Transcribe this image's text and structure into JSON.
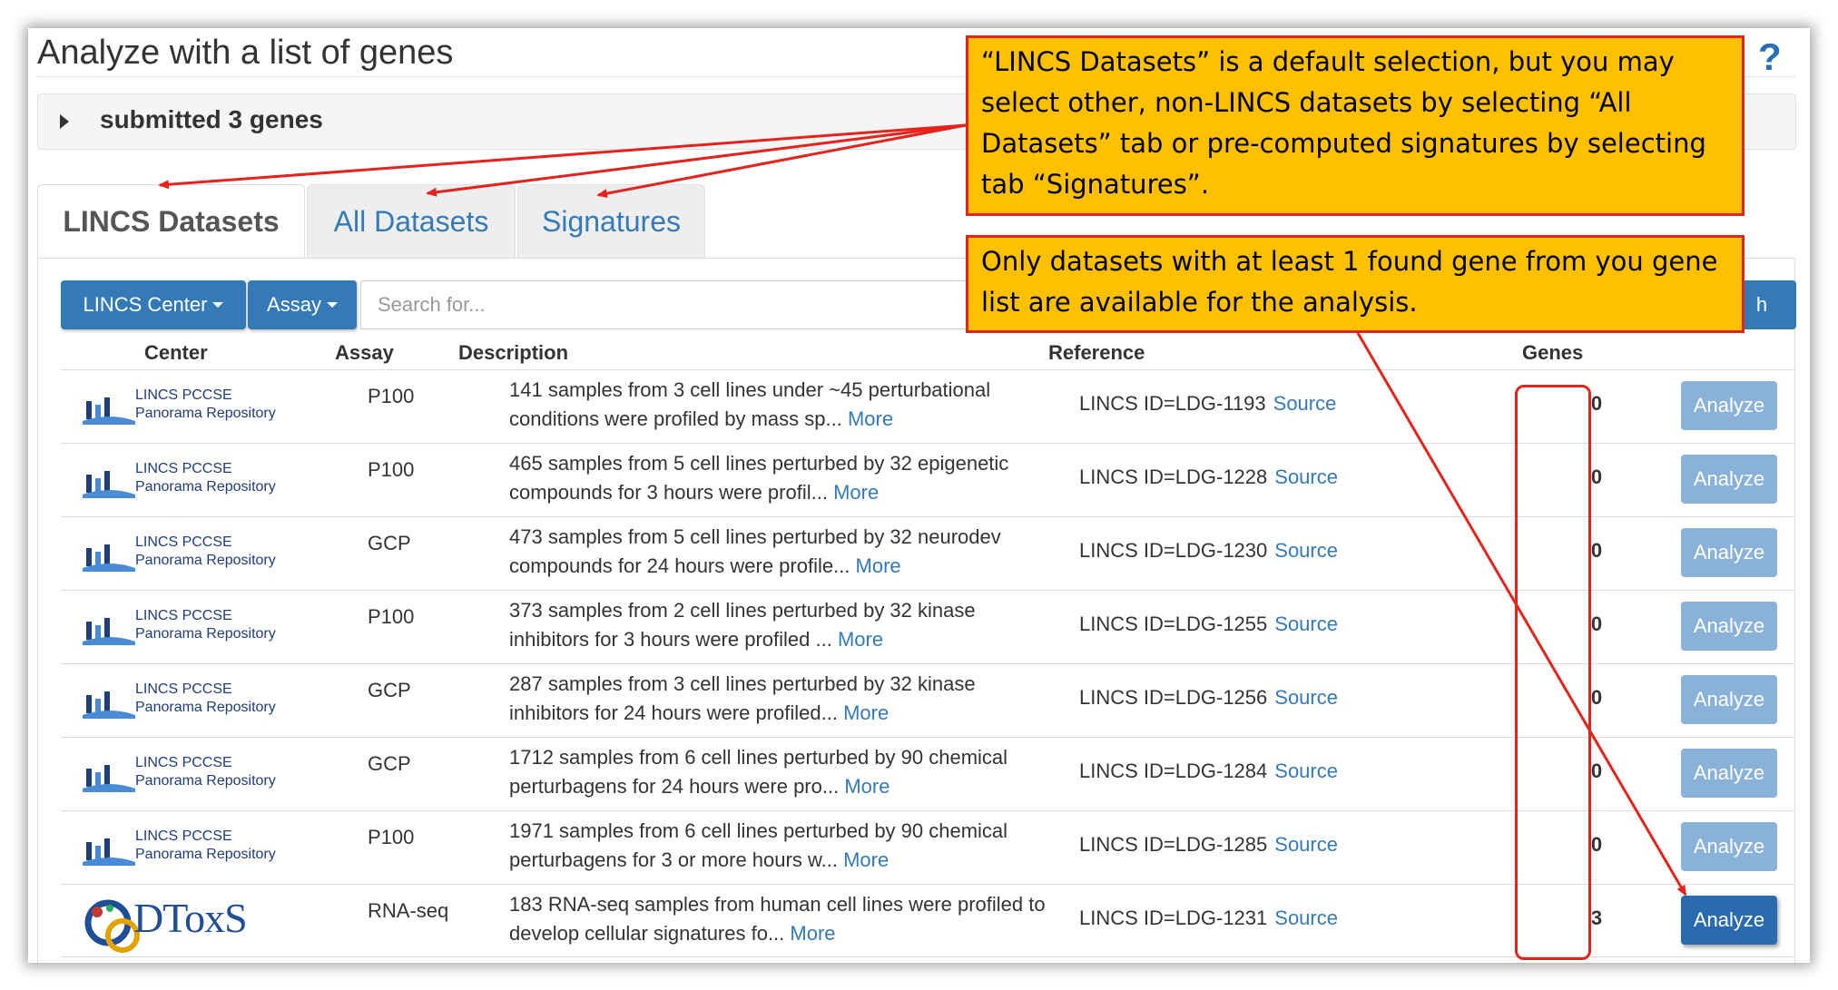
{
  "page": {
    "title": "Analyze with a list of genes",
    "help_symbol": "?"
  },
  "genes_panel": {
    "label": "submitted 3 genes"
  },
  "tabs": [
    {
      "label": "LINCS Datasets",
      "active": true
    },
    {
      "label": "All Datasets",
      "active": false
    },
    {
      "label": "Signatures",
      "active": false
    }
  ],
  "filters": {
    "center_label": "LINCS Center",
    "assay_label": "Assay",
    "search_placeholder": "Search for...",
    "search_button_label": "h"
  },
  "table": {
    "headers": {
      "center": "Center",
      "assay": "Assay",
      "description": "Description",
      "reference": "Reference",
      "genes": "Genes"
    },
    "more_label": "More",
    "source_label": "Source",
    "analyze_label": "Analyze",
    "rows": [
      {
        "center_line1": "LINCS PCCSE",
        "center_line2": "Panorama Repository",
        "assay": "P100",
        "description": "141 samples from 3 cell lines under ~45 perturbational conditions were profiled by mass sp...",
        "reference": "LINCS ID=LDG-1193",
        "genes": "0",
        "enabled": false
      },
      {
        "center_line1": "LINCS PCCSE",
        "center_line2": "Panorama Repository",
        "assay": "P100",
        "description": "465 samples from 5 cell lines perturbed by 32 epigenetic compounds for 3 hours were profil...",
        "reference": "LINCS ID=LDG-1228",
        "genes": "0",
        "enabled": false
      },
      {
        "center_line1": "LINCS PCCSE",
        "center_line2": "Panorama Repository",
        "assay": "GCP",
        "description": "473 samples from 5 cell lines perturbed by 32 neurodev compounds for 24 hours were profile...",
        "reference": "LINCS ID=LDG-1230",
        "genes": "0",
        "enabled": false
      },
      {
        "center_line1": "LINCS PCCSE",
        "center_line2": "Panorama Repository",
        "assay": "P100",
        "description": "373 samples from 2 cell lines perturbed by 32 kinase inhibitors for 3 hours were profiled ...",
        "reference": "LINCS ID=LDG-1255",
        "genes": "0",
        "enabled": false
      },
      {
        "center_line1": "LINCS PCCSE",
        "center_line2": "Panorama Repository",
        "assay": "GCP",
        "description": "287 samples from 3 cell lines perturbed by 32 kinase inhibitors for 24 hours were profiled...",
        "reference": "LINCS ID=LDG-1256",
        "genes": "0",
        "enabled": false
      },
      {
        "center_line1": "LINCS PCCSE",
        "center_line2": "Panorama Repository",
        "assay": "GCP",
        "description": "1712 samples from 6 cell lines perturbed by 90 chemical perturbagens for 24 hours were pro...",
        "reference": "LINCS ID=LDG-1284",
        "genes": "0",
        "enabled": false
      },
      {
        "center_line1": "LINCS PCCSE",
        "center_line2": "Panorama Repository",
        "assay": "P100",
        "description": "1971 samples from 6 cell lines perturbed by 90 chemical perturbagens for 3 or more hours w...",
        "reference": "LINCS ID=LDG-1285",
        "genes": "0",
        "enabled": false
      },
      {
        "center_logo": "DToxS",
        "assay": "RNA-seq",
        "description": "183 RNA-seq samples from human cell lines were profiled to develop cellular signatures fo...",
        "reference": "LINCS ID=LDG-1231",
        "genes": "3",
        "enabled": true
      }
    ]
  },
  "annotations": {
    "callout_1": "“LINCS Datasets” is a default selection, but you may select other, non-LINCS datasets by selecting “All Datasets” tab or pre-computed signatures by selecting tab “Signatures”.",
    "callout_2": "Only datasets with at least 1 found gene from you gene list are available for the analysis.",
    "accent_color": "#e5231b",
    "callout_fill": "#ffc000"
  },
  "colors": {
    "primary": "#337ab7",
    "disabled_button": "#8ab2d9"
  }
}
